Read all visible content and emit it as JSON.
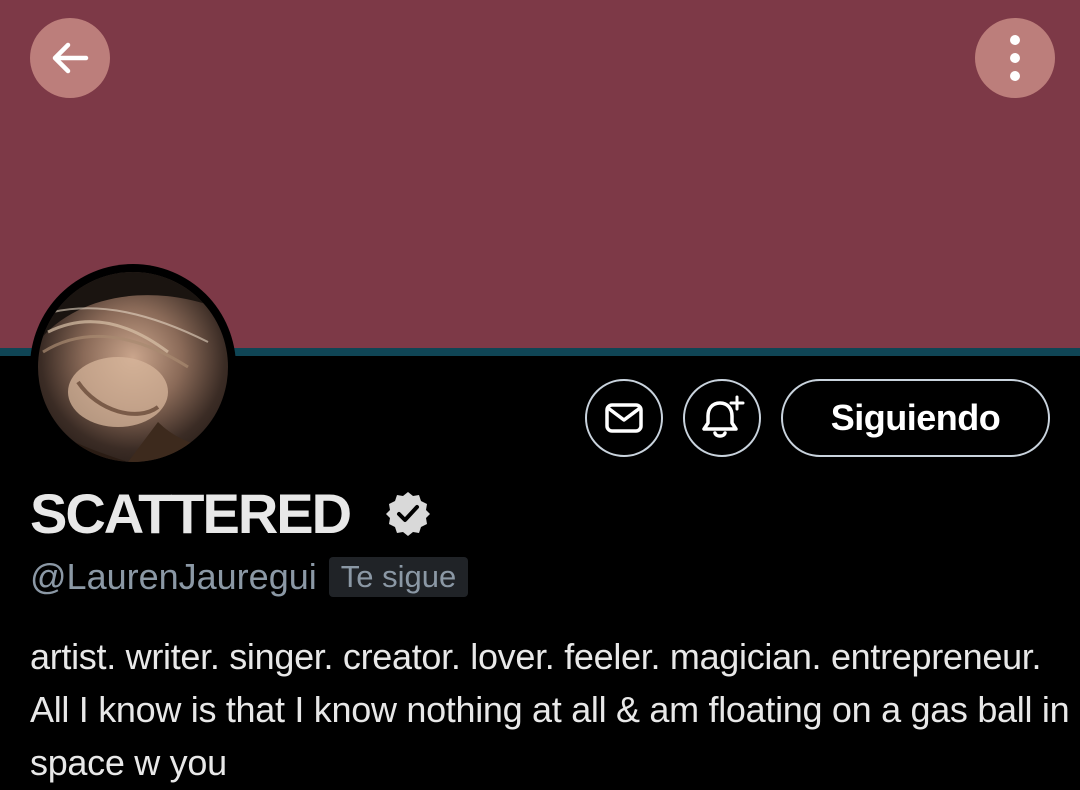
{
  "header": {
    "banner_color": "#7d3947",
    "back_icon": "arrow-left-icon",
    "more_icon": "more-vertical-icon"
  },
  "profile": {
    "display_name": "SCATTERED",
    "verified_icon": "verified-badge-icon",
    "handle": "@LaurenJauregui",
    "follows_you_label": "Te sigue",
    "bio": "artist. writer. singer. creator. lover. feeler. magician. entrepreneur. All I know is that I know nothing at all & am floating on a gas ball in space w you"
  },
  "actions": {
    "message_icon": "envelope-icon",
    "notify_icon": "bell-plus-icon",
    "follow_label": "Siguiendo"
  }
}
